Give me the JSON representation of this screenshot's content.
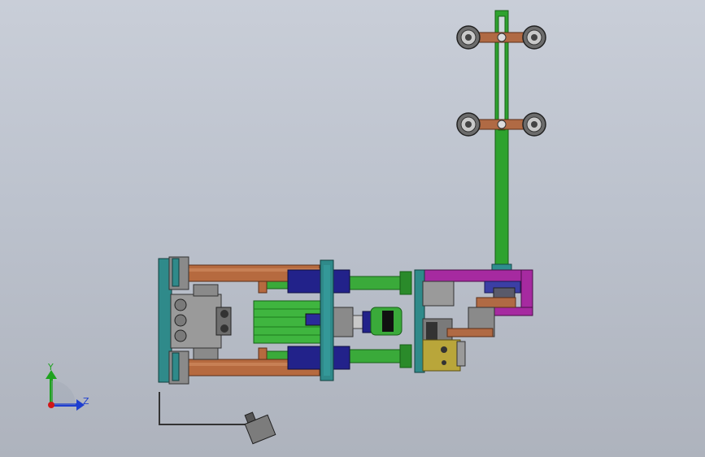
{
  "viewport": {
    "view_orientation": "front",
    "background_top": "#c9ced8",
    "background_bottom": "#aeb3bd"
  },
  "triad": {
    "y_label": "Y",
    "z_label": "Z",
    "y_color": "#1fa21f",
    "z_color": "#1f3fcf",
    "origin_color": "#d01818"
  },
  "model": {
    "parts": [
      "left-end-plate",
      "middle-plate",
      "right-bracket-plate",
      "upper-guide-rod",
      "lower-guide-rod",
      "air-cylinder",
      "green-shafts",
      "purple-bracket",
      "vertical-slide-bar",
      "upper-roller-pair",
      "lower-roller-pair",
      "yellow-valve-block",
      "sensor-cable",
      "sensor-head"
    ],
    "colors": {
      "teal": "#2f8a8a",
      "copper": "#b66a3f",
      "green": "#34a534",
      "navy": "#20208a",
      "purple": "#a62aa0",
      "yellow": "#b9a63a",
      "gray": "#8a8a8a"
    }
  }
}
